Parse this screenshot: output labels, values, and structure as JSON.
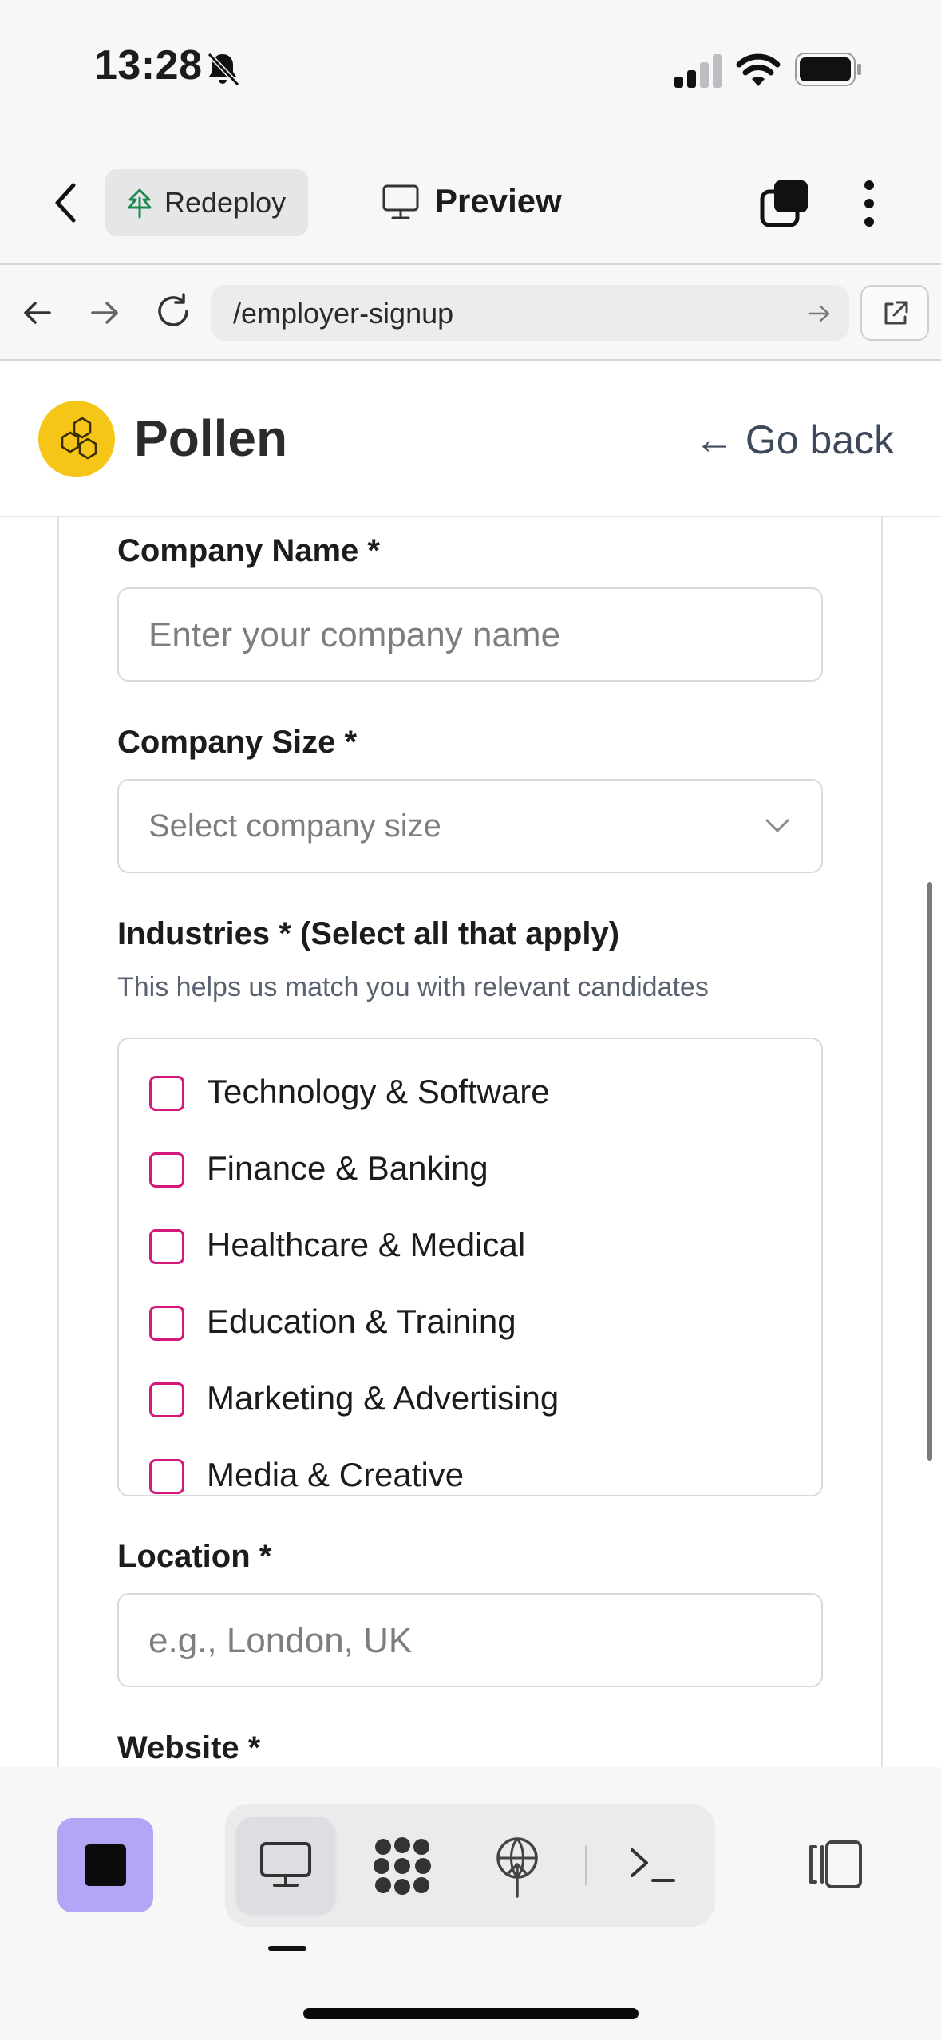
{
  "status_bar": {
    "time": "13:28"
  },
  "toolbar": {
    "redeploy_label": "Redeploy",
    "preview_label": "Preview"
  },
  "browser": {
    "url": "/employer-signup"
  },
  "app": {
    "brand": "Pollen",
    "go_back": "← Go back"
  },
  "form": {
    "company_name": {
      "label": "Company Name *",
      "placeholder": "Enter your company name"
    },
    "company_size": {
      "label": "Company Size *",
      "placeholder": "Select company size"
    },
    "industries": {
      "label": "Industries * (Select all that apply)",
      "help": "This helps us match you with relevant candidates",
      "options": [
        "Technology & Software",
        "Finance & Banking",
        "Healthcare & Medical",
        "Education & Training",
        "Marketing & Advertising",
        "Media & Creative"
      ]
    },
    "location": {
      "label": "Location *",
      "placeholder": "e.g., London, UK"
    },
    "website": {
      "label": "Website *"
    }
  },
  "colors": {
    "checkbox_accent": "#d4197a",
    "logo_yellow": "#f5c518",
    "stop_button": "#b4a6f7"
  },
  "icons": [
    "back-chevron-icon",
    "tree-icon",
    "monitor-icon",
    "tabs-icon",
    "more-icon",
    "arrow-left-icon",
    "arrow-right-icon",
    "reload-icon",
    "go-arrow-icon",
    "external-link-icon",
    "honeycomb-icon",
    "chevron-down-icon",
    "stop-icon",
    "grid-icon",
    "deploy-icon",
    "terminal-icon",
    "panel-icon"
  ]
}
